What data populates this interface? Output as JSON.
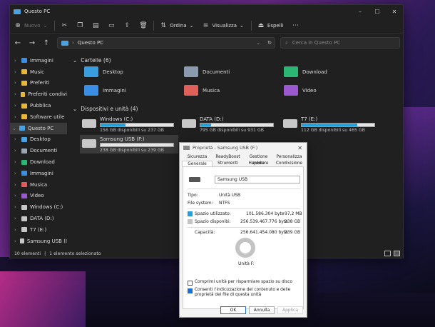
{
  "window": {
    "title": "Questo PC",
    "min": "–",
    "max": "☐",
    "close": "✕"
  },
  "cmdbar": {
    "new_label": "Nuovo",
    "sort_label": "Ordina",
    "view_label": "Visualizza",
    "more_label": "Espelli"
  },
  "address": {
    "path": "Questo PC"
  },
  "search": {
    "placeholder": "Cerca in Questo PC"
  },
  "sidebar": {
    "items": [
      {
        "label": "Immagini",
        "color": "#3a8ee6"
      },
      {
        "label": "Music",
        "color": "#e8b73a"
      },
      {
        "label": "Preferiti",
        "color": "#e8b73a"
      },
      {
        "label": "Preferiti condivi",
        "color": "#e8b73a"
      },
      {
        "label": "Pubblica",
        "color": "#e8b73a"
      },
      {
        "label": "Software utile",
        "color": "#e8b73a"
      },
      {
        "label": "Questo PC",
        "color": "#4aa3e0"
      },
      {
        "label": "Desktop",
        "color": "#4aa3e0"
      },
      {
        "label": "Documenti",
        "color": "#9aa6b2"
      },
      {
        "label": "Download",
        "color": "#2bb673"
      },
      {
        "label": "Immagini",
        "color": "#3a8ee6"
      },
      {
        "label": "Musica",
        "color": "#e05a5a"
      },
      {
        "label": "Video",
        "color": "#9b59d0"
      },
      {
        "label": "Windows (C:)",
        "color": "#c8c8c8"
      },
      {
        "label": "DATA (D:)",
        "color": "#c8c8c8"
      },
      {
        "label": "T7 (E:)",
        "color": "#c8c8c8"
      },
      {
        "label": "Samsung USB (I",
        "color": "#c8c8c8"
      }
    ]
  },
  "sections": {
    "folders": "Cartelle (6)",
    "drives": "Dispositivi e unità (4)"
  },
  "folders": [
    {
      "label": "Desktop",
      "color": "#3a9de0"
    },
    {
      "label": "Documenti",
      "color": "#8a9bb0"
    },
    {
      "label": "Download",
      "color": "#2bb673"
    },
    {
      "label": "Immagini",
      "color": "#3a8ee6"
    },
    {
      "label": "Musica",
      "color": "#e0605a"
    },
    {
      "label": "Video",
      "color": "#9b59d0"
    }
  ],
  "drives": [
    {
      "name": "Windows (C:)",
      "info": "156 GB disponibili su 237 GB",
      "used_fraction": 0.34
    },
    {
      "name": "DATA (D:)",
      "info": "795 GB disponibili su 931 GB",
      "used_fraction": 0.15
    },
    {
      "name": "T7 (E:)",
      "info": "112 GB disponibili su 465 GB",
      "used_fraction": 0.76
    },
    {
      "name": "Samsung USB (F:)",
      "info": "238 GB disponibili su 239 GB",
      "used_fraction": 0.0
    }
  ],
  "status": {
    "count": "10 elementi",
    "selected": "1 elemento selezionato"
  },
  "dialog": {
    "title": "Proprietà - Samsung USB (F:)",
    "tabs_top": [
      "Sicurezza",
      "ReadyBoost",
      "Gestione quote",
      "Personalizza"
    ],
    "tabs_bottom": [
      "Generale",
      "Strumenti",
      "Hardware",
      "Condivisione"
    ],
    "name_value": "Samsung USB",
    "type_label": "Tipo:",
    "type_value": "Unità USB",
    "fs_label": "File system:",
    "fs_value": "NTFS",
    "used_label": "Spazio utilizzato:",
    "used_bytes": "101.586.304 byte",
    "used_short": "97,2 MB",
    "free_label": "Spazio disponibi:",
    "free_bytes": "256.539.467.776 byte",
    "free_short": "238 GB",
    "cap_label": "Capacità:",
    "cap_bytes": "256.641.454.080 byte",
    "cap_short": "239 GB",
    "drive_label": "Unità F:",
    "compress_label": "Comprimi unità per risparmiare spazio su disco",
    "index_label": "Consenti l'indicizzazione del contenuto e delle proprietà dei file di questa unità",
    "ok": "OK",
    "cancel": "Annulla",
    "apply": "Applica",
    "used_color": "#26a0da",
    "free_color": "#c3c3c3"
  }
}
